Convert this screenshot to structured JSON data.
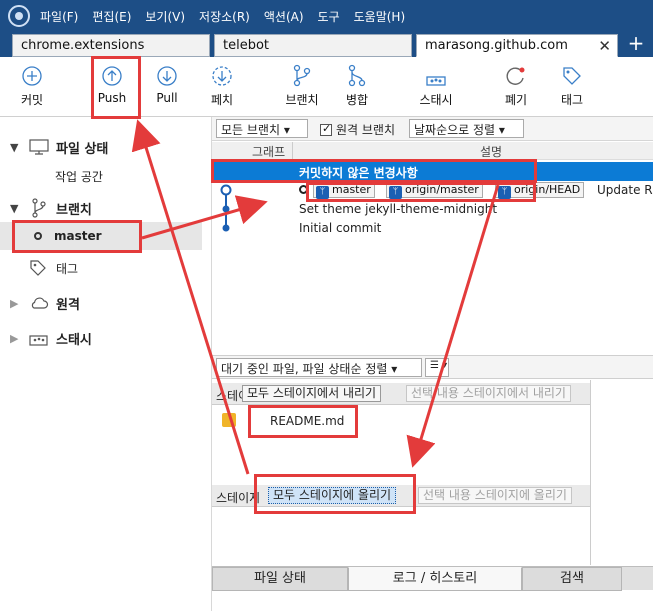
{
  "menu": [
    "파일(F)",
    "편집(E)",
    "보기(V)",
    "저장소(R)",
    "액션(A)",
    "도구",
    "도움말(H)"
  ],
  "tabs": [
    {
      "label": "chrome.extensions"
    },
    {
      "label": "telebot"
    },
    {
      "label": "marasong.github.com",
      "close": "✕"
    }
  ],
  "tab_add": "+",
  "toolbar": {
    "commit": "커밋",
    "push": "Push",
    "pull": "Pull",
    "fetch": "페치",
    "branch": "브랜치",
    "merge": "병합",
    "stash": "스태시",
    "discard": "폐기",
    "tag": "태그"
  },
  "sidebar": {
    "file_status": "파일 상태",
    "workspace": "작업 공간",
    "branches": "브랜치",
    "master": "master",
    "tags": "태그",
    "remotes": "원격",
    "stashes": "스태시"
  },
  "graph": {
    "all_branches": "모든 브랜치 ▾",
    "remote_branches": "원격 브랜치",
    "sort": "날짜순으로 정렬 ▾",
    "col_graph": "그래프",
    "col_desc": "설명",
    "uncommitted": "커밋하지 않은 변경사항",
    "refs": [
      "master",
      "origin/master",
      "origin/HEAD"
    ],
    "ref_msg": "Update RE",
    "commit2": "Set theme jekyll-theme-midnight",
    "commit3": "Initial commit"
  },
  "lower": {
    "pending_sort": "대기 중인 파일, 파일 상태순 정렬 ▾",
    "view_menu": "☰ ▾",
    "staged_title": "스테이",
    "unstage_all": "모두 스테이지에서 내리기",
    "unstage_selected": "선택 내용 스테이지에서 내리기",
    "file": "README.md",
    "unstaged_title": "스테이지",
    "stage_all": "모두 스테이지에 올리기",
    "stage_selected": "선택 내용 스테이지에 올리기"
  },
  "bottom_tabs": [
    "파일 상태",
    "로그 / 히스토리",
    "검색"
  ],
  "colors": {
    "header": "#1d4e86",
    "selection": "#0c7bd5",
    "annotation": "#e33b3b"
  }
}
